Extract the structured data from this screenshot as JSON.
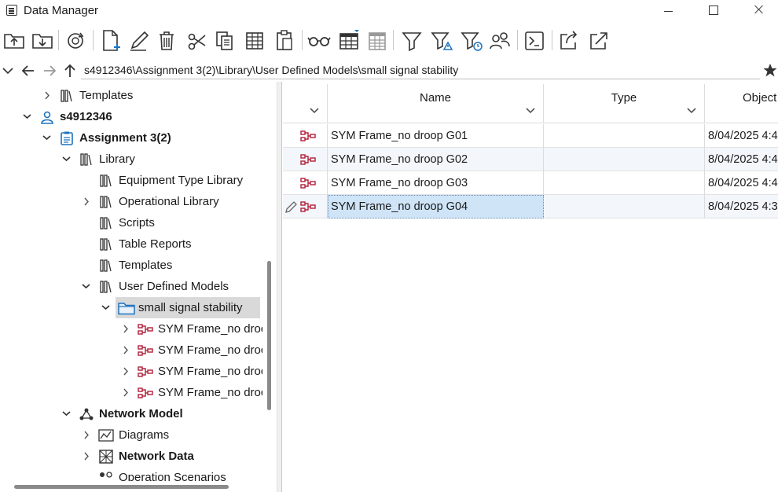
{
  "window": {
    "title": "Data Manager"
  },
  "address": {
    "path": "s4912346\\Assignment 3(2)\\Library\\User Defined Models\\small signal stability"
  },
  "tree": [
    {
      "label": "Templates",
      "bold": false
    },
    {
      "label": "s4912346",
      "bold": true
    },
    {
      "label": "Assignment 3(2)",
      "bold": true
    },
    {
      "label": "Library",
      "bold": false
    },
    {
      "label": "Equipment Type Library",
      "bold": false
    },
    {
      "label": "Operational Library",
      "bold": false
    },
    {
      "label": "Scripts",
      "bold": false
    },
    {
      "label": "Table Reports",
      "bold": false
    },
    {
      "label": "Templates",
      "bold": false
    },
    {
      "label": "User Defined Models",
      "bold": false
    },
    {
      "label": "small signal stability",
      "bold": false
    },
    {
      "label": "SYM Frame_no droc",
      "bold": false
    },
    {
      "label": "SYM Frame_no droc",
      "bold": false
    },
    {
      "label": "SYM Frame_no droc",
      "bold": false
    },
    {
      "label": "SYM Frame_no droc",
      "bold": false
    },
    {
      "label": "Network Model",
      "bold": true
    },
    {
      "label": "Diagrams",
      "bold": false
    },
    {
      "label": "Network Data",
      "bold": true
    },
    {
      "label": "Operation Scenarios",
      "bold": false
    }
  ],
  "grid": {
    "columns": [
      "Name",
      "Type",
      "Object"
    ],
    "rows": [
      {
        "name": "SYM Frame_no droop G01",
        "type": "",
        "object": "8/04/2025 4:4"
      },
      {
        "name": "SYM Frame_no droop G02",
        "type": "",
        "object": "8/04/2025 4:4"
      },
      {
        "name": "SYM Frame_no droop G03",
        "type": "",
        "object": "8/04/2025 4:4"
      },
      {
        "name": "SYM Frame_no droop G04",
        "type": "",
        "object": "8/04/2025 4:3"
      }
    ]
  },
  "colors": {
    "accent": "#1e73be",
    "frame_icon": "#b0203a",
    "selection": "#cfe4f7"
  }
}
